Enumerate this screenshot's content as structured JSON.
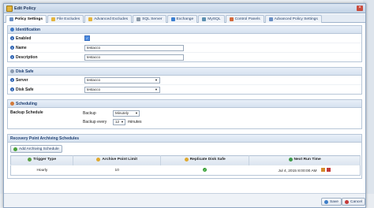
{
  "dialog": {
    "title": "Edit Policy"
  },
  "tabs": [
    {
      "label": "Policy Settings",
      "icon": "gear-icon",
      "active": true
    },
    {
      "label": "File Excludes",
      "icon": "folder-icon"
    },
    {
      "label": "Advanced Excludes",
      "icon": "folder-icon"
    },
    {
      "label": "SQL Server",
      "icon": "database-icon"
    },
    {
      "label": "Exchange",
      "icon": "mail-icon"
    },
    {
      "label": "MySQL",
      "icon": "database-icon"
    },
    {
      "label": "Control Panels",
      "icon": "panel-icon"
    },
    {
      "label": "Advanced Policy Settings",
      "icon": "gear-icon"
    }
  ],
  "identification": {
    "title": "Identification",
    "enabled_label": "Enabled",
    "name_label": "Name",
    "name_value": "testacco",
    "description_label": "Description",
    "description_value": "testacco"
  },
  "disk_safe": {
    "title": "Disk Safe",
    "server_label": "Server",
    "server_value": "testacco",
    "disk_safe_label": "Disk Safe",
    "disk_safe_value": "testacco"
  },
  "scheduling": {
    "title": "Scheduling",
    "backup_schedule_label": "Backup Schedule",
    "backup_label": "Backup",
    "backup_value": "Minutely",
    "backup_every_label": "Backup every",
    "backup_every_value": "12",
    "minutes_label": "minutes"
  },
  "archiving": {
    "title": "Recovery Point Archiving Schedules",
    "add_button": "Add Archiving Schedule",
    "columns": [
      "Trigger Type",
      "Archive Point Limit",
      "Replicate Disk Safe",
      "Next Run Time"
    ],
    "rows": [
      {
        "trigger": "Hourly",
        "limit": "10",
        "next_run": "Jul 4, 2015 8:00:00 AM"
      }
    ]
  },
  "footer": {
    "save": "Save",
    "cancel": "Cancel"
  },
  "colors": {
    "accent": "#1e3f72",
    "header_bg": "#d6e2f0",
    "check": "#4c8be0"
  }
}
